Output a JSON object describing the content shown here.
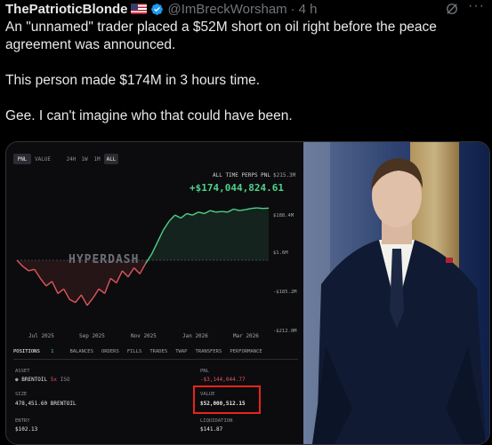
{
  "post": {
    "display_name": "ThePatrioticBlonde",
    "handle": "@ImBreckWorsham",
    "separator": "·",
    "time": "4 h",
    "more": "···",
    "paragraphs": [
      "An \"unnamed\" trader placed a $52M short on oil right before the peace agreement was announced.",
      "This person made $174M in 3 hours time.",
      "Gee. I can't imagine who that could have been."
    ]
  },
  "dashboard": {
    "toggle": [
      "PNL",
      "VALUE"
    ],
    "ranges": [
      "24H",
      "1W",
      "1M",
      "ALL"
    ],
    "active_range": "ALL",
    "chart_title": "ALL TIME PERPS PNL",
    "chart_top_value": "$215.3M",
    "pnl_total": "+$174,044,824.61",
    "watermark": "HYPERDASH",
    "tabs": [
      "POSITIONS",
      "BALANCES",
      "ORDERS",
      "FILLS",
      "TRADES",
      "TWAP",
      "TRANSFERS",
      "PERFORMANCE"
    ],
    "positions_count": "1",
    "asset_label": "ASSET",
    "asset_name": "BRENTOIL",
    "asset_leverage": "5x",
    "asset_margin": "ISO",
    "pnl_label": "PNL",
    "pnl_value": "-$3,144,044.77",
    "size_label": "SIZE",
    "size_value": "478,451.60 BRENTOIL",
    "value_label": "VALUE",
    "value_value": "$52,000,512.15",
    "entry_label": "ENTRY",
    "entry_value": "$102.13",
    "liq_label": "LIQUIDATION",
    "liq_value": "$141.87"
  },
  "chart_data": {
    "type": "line",
    "title": "ALL TIME PERPS PNL",
    "x": [
      "Jul 2025",
      "Sep 2025",
      "Nov 2025",
      "Jan 2026",
      "Mar 2026"
    ],
    "y_ticks": [
      "$188.4M",
      "$1.6M",
      "-$185.2M",
      "-$212.0M"
    ],
    "series": [
      {
        "values": [
          0,
          -20,
          -35,
          -30,
          -60,
          -85,
          -70,
          -110,
          -95,
          -130,
          -140,
          -115,
          -150,
          -125,
          -95,
          -110,
          -60,
          -75,
          -35,
          -55,
          -25,
          -45,
          -10,
          20,
          60,
          100,
          130,
          150,
          140,
          155,
          150,
          160,
          155,
          165,
          160,
          162,
          160,
          170,
          165,
          168,
          172,
          174,
          172,
          173
        ]
      }
    ],
    "colors": {
      "positive": "#4fd18b",
      "negative": "#e0575b"
    },
    "ylim": [
      -212.0,
      215.3
    ]
  }
}
